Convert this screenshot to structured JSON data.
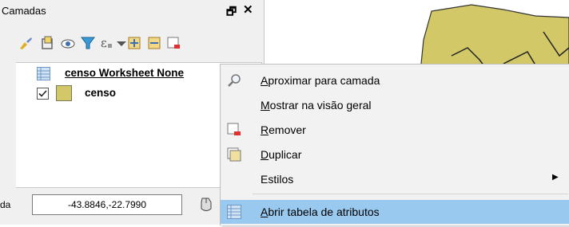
{
  "panel": {
    "title": "Camadas",
    "float_glyph": "🗗",
    "close_glyph": "✕"
  },
  "layers": [
    {
      "label": "censo Worksheet None",
      "icon": "table-icon"
    },
    {
      "label": "censo",
      "icon": "polygon-layer-swatch",
      "checked": true,
      "color": "#d3c868"
    }
  ],
  "status": {
    "label": "da",
    "coord_value": "-43.8846,-22.7990"
  },
  "context_menu": {
    "items": [
      {
        "label": "Aproximar para camada",
        "accel": "A",
        "icon": "zoom-icon"
      },
      {
        "label": "Mostrar na visão geral",
        "accel": "M",
        "icon": "none"
      },
      {
        "label": "Remover",
        "accel": "R",
        "icon": "remove-layer-icon"
      },
      {
        "label": "Duplicar",
        "accel": "D",
        "icon": "duplicate-layer-icon"
      },
      {
        "label": "Estilos",
        "accel": "",
        "icon": "none",
        "submenu": true
      },
      {
        "label": "Abrir tabela de atributos",
        "accel": "A",
        "icon": "table-icon",
        "highlighted": true
      }
    ],
    "highlight_color": "#99c9ef"
  },
  "map": {
    "polygon_color": "#d3c868"
  }
}
